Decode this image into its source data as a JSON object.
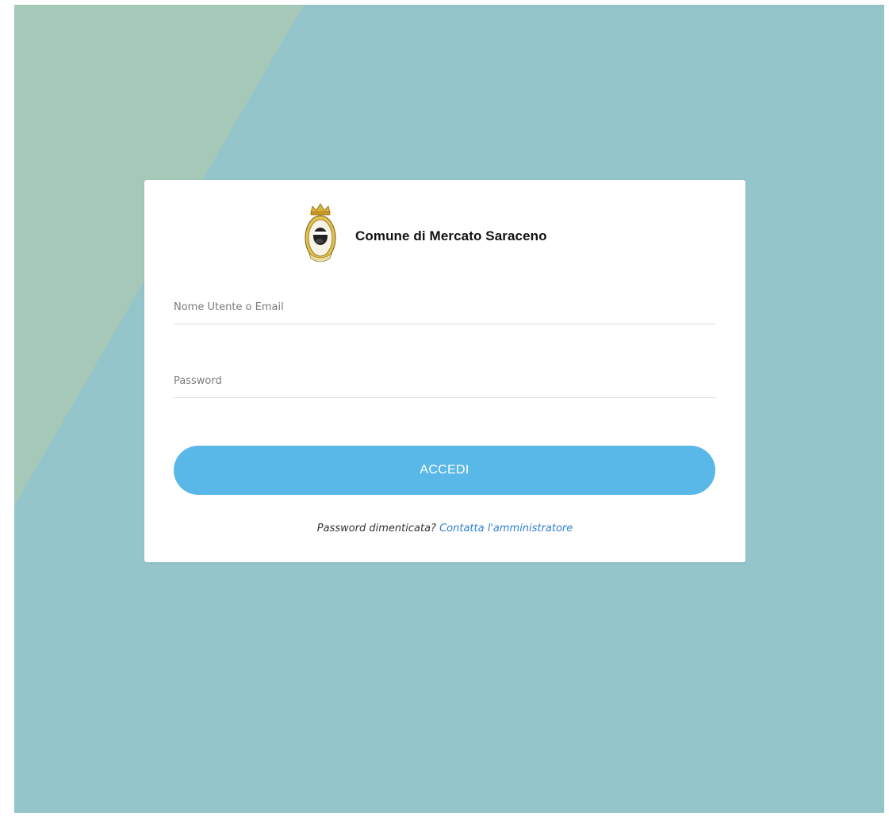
{
  "brand": {
    "name": "Comune di Mercato Saraceno",
    "logo_icon": "municipal-crest-icon"
  },
  "form": {
    "username": {
      "placeholder": "Nome Utente o Email",
      "value": ""
    },
    "password": {
      "placeholder": "Password",
      "value": ""
    },
    "submit_label": "ACCEDI"
  },
  "recovery": {
    "prompt": "Password dimenticata?",
    "link_label": "Contatta l'amministratore"
  },
  "colors": {
    "background": "#93c5ca",
    "background_accent": "#a5c8b9",
    "card": "#ffffff",
    "button": "#5ab8e8",
    "link": "#2f7fd1"
  }
}
